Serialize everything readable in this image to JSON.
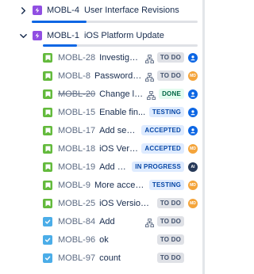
{
  "epics": [
    {
      "key": "MOBL-4",
      "title": "User Interface Revisions",
      "expanded": false,
      "chevron_icon": "chevron-right-icon",
      "icon": "epic-lightning-icon",
      "progress_done": 0.33
    },
    {
      "key": "MOBL-1",
      "title": "iOS Platform Update",
      "expanded": true,
      "chevron_icon": "chevron-down-icon",
      "icon": "epic-lightning-icon",
      "progress_done": 0.22
    }
  ],
  "children": [
    {
      "type": "story",
      "key": "MOBL-28",
      "title": "Investigating the...",
      "has_child_icon": true,
      "status": "TO DO",
      "status_style": "todo",
      "avatar": "blue",
      "avatar_text": ""
    },
    {
      "type": "story",
      "key": "MOBL-8",
      "title": "Password s...",
      "has_child_icon": true,
      "status": "TO DO",
      "status_style": "todo",
      "avatar": "orange",
      "avatar_text": "MD"
    },
    {
      "type": "story",
      "key": "MOBL-20",
      "title": "Change lo...",
      "has_child_icon": true,
      "status": "DONE",
      "status_style": "done",
      "done": true,
      "avatar": "blue",
      "avatar_text": ""
    },
    {
      "type": "story",
      "key": "MOBL-15",
      "title": "Enable fin...",
      "has_child_icon": false,
      "status": "TESTING",
      "status_style": "blue",
      "avatar": "blue",
      "avatar_text": ""
    },
    {
      "type": "story",
      "key": "MOBL-17",
      "title": "Add secu...",
      "has_child_icon": false,
      "status": "ACCEPTED",
      "status_style": "blue",
      "avatar": "blue",
      "avatar_text": ""
    },
    {
      "type": "story",
      "key": "MOBL-18",
      "title": "iOS Versi...",
      "has_child_icon": false,
      "status": "ACCEPTED",
      "status_style": "blue",
      "avatar": "orange",
      "avatar_text": "MD"
    },
    {
      "type": "story",
      "key": "MOBL-19",
      "title": "Add B...",
      "has_child_icon": false,
      "status": "IN PROGRESS",
      "status_style": "blue",
      "avatar": "dark",
      "avatar_text": "AI"
    },
    {
      "type": "story",
      "key": "MOBL-9",
      "title": "More acces...",
      "has_child_icon": false,
      "status": "TESTING",
      "status_style": "blue",
      "avatar": "orange",
      "avatar_text": "MD"
    },
    {
      "type": "story",
      "key": "MOBL-25",
      "title": "iOS Version ...",
      "has_child_icon": false,
      "status": "TO DO",
      "status_style": "todo",
      "avatar": "orange",
      "avatar_text": "MD"
    },
    {
      "type": "task",
      "key": "MOBL-84",
      "title": "Add",
      "has_child_icon": true,
      "status": "TO DO",
      "status_style": "todo",
      "avatar": "",
      "avatar_text": ""
    },
    {
      "type": "task",
      "key": "MOBL-96",
      "title": "ok",
      "has_child_icon": false,
      "status": "TO DO",
      "status_style": "todo",
      "avatar": "",
      "avatar_text": ""
    },
    {
      "type": "task",
      "key": "MOBL-97",
      "title": "count",
      "has_child_icon": false,
      "status": "TO DO",
      "status_style": "todo",
      "avatar": "",
      "avatar_text": ""
    }
  ],
  "colors": {
    "epic": "#904ee2",
    "story": "#63ba3c",
    "task": "#4bade8",
    "progress_done": "#0c66e4",
    "progress_rest": "#dfe1e6"
  }
}
